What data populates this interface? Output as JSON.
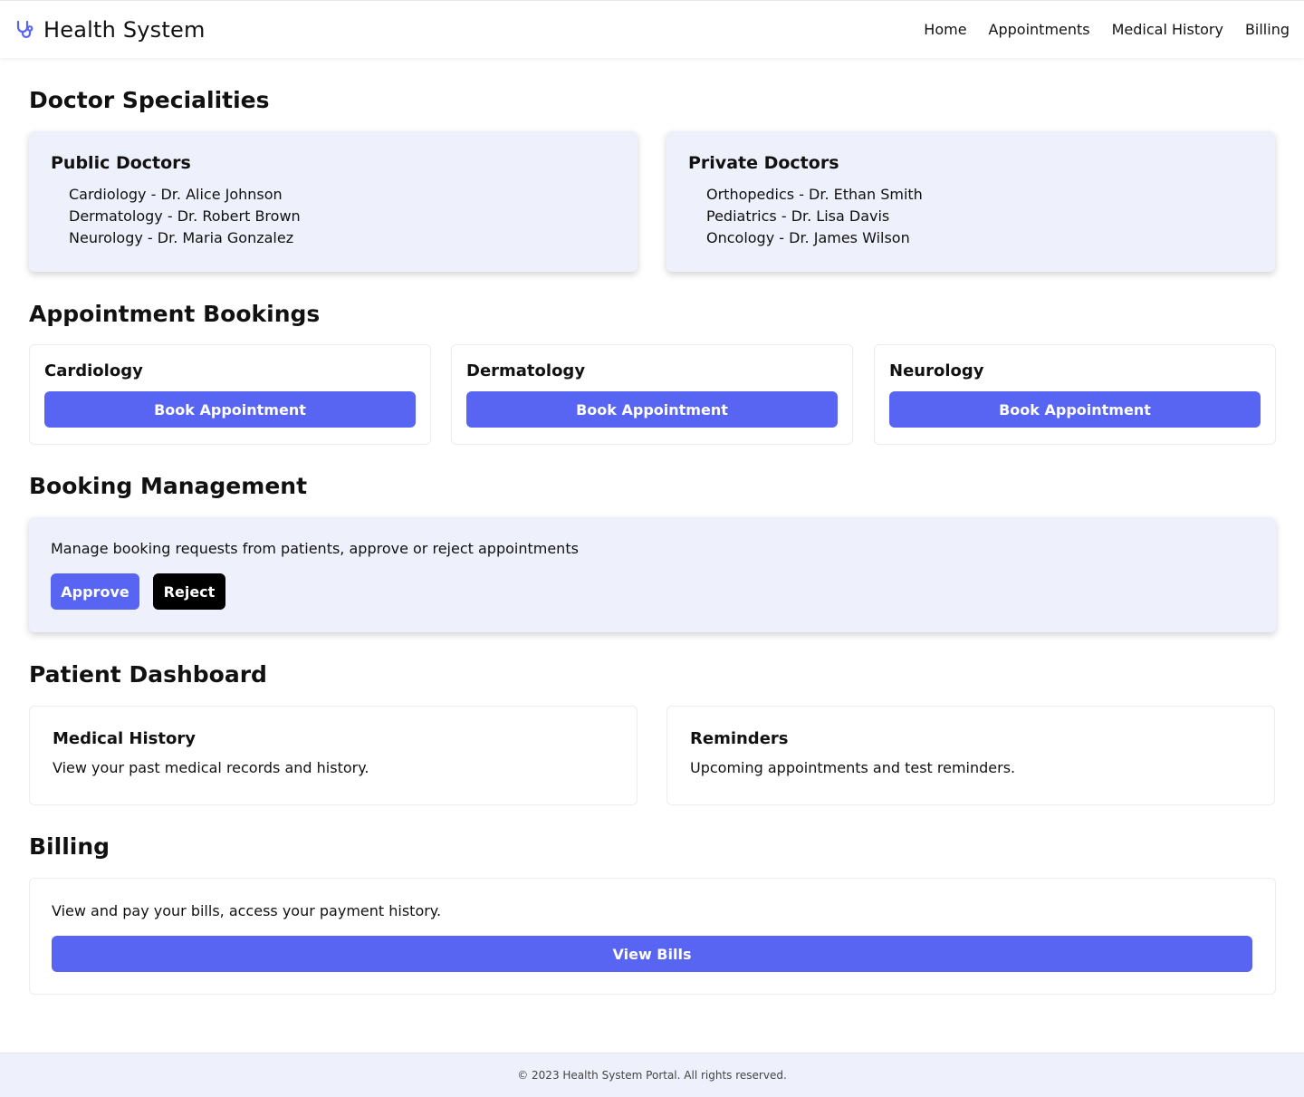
{
  "brand": {
    "title": "Health System",
    "icon": "stethoscope-icon",
    "icon_color": "#5865f2"
  },
  "nav": {
    "home": "Home",
    "appointments": "Appointments",
    "medical_history": "Medical History",
    "billing": "Billing"
  },
  "specialities": {
    "title": "Doctor Specialities",
    "public": {
      "heading": "Public Doctors",
      "doctors": [
        "Cardiology - Dr. Alice Johnson",
        "Dermatology - Dr. Robert Brown",
        "Neurology - Dr. Maria Gonzalez"
      ]
    },
    "private": {
      "heading": "Private Doctors",
      "doctors": [
        "Orthopedics - Dr. Ethan Smith",
        "Pediatrics - Dr. Lisa Davis",
        "Oncology - Dr. James Wilson"
      ]
    }
  },
  "bookings": {
    "title": "Appointment Bookings",
    "items": [
      {
        "name": "Cardiology",
        "button": "Book Appointment"
      },
      {
        "name": "Dermatology",
        "button": "Book Appointment"
      },
      {
        "name": "Neurology",
        "button": "Book Appointment"
      }
    ]
  },
  "management": {
    "title": "Booking Management",
    "description": "Manage booking requests from patients, approve or reject appointments",
    "approve": "Approve",
    "reject": "Reject"
  },
  "dashboard": {
    "title": "Patient Dashboard",
    "history": {
      "heading": "Medical History",
      "text": "View your past medical records and history."
    },
    "reminders": {
      "heading": "Reminders",
      "text": "Upcoming appointments and test reminders."
    }
  },
  "billing": {
    "title": "Billing",
    "description": "View and pay your bills, access your payment history.",
    "button": "View Bills"
  },
  "footer": {
    "text": "© 2023 Health System Portal. All rights reserved."
  },
  "colors": {
    "accent": "#5865f2",
    "card_bg": "#eef0fc",
    "dark_button": "#000000"
  }
}
